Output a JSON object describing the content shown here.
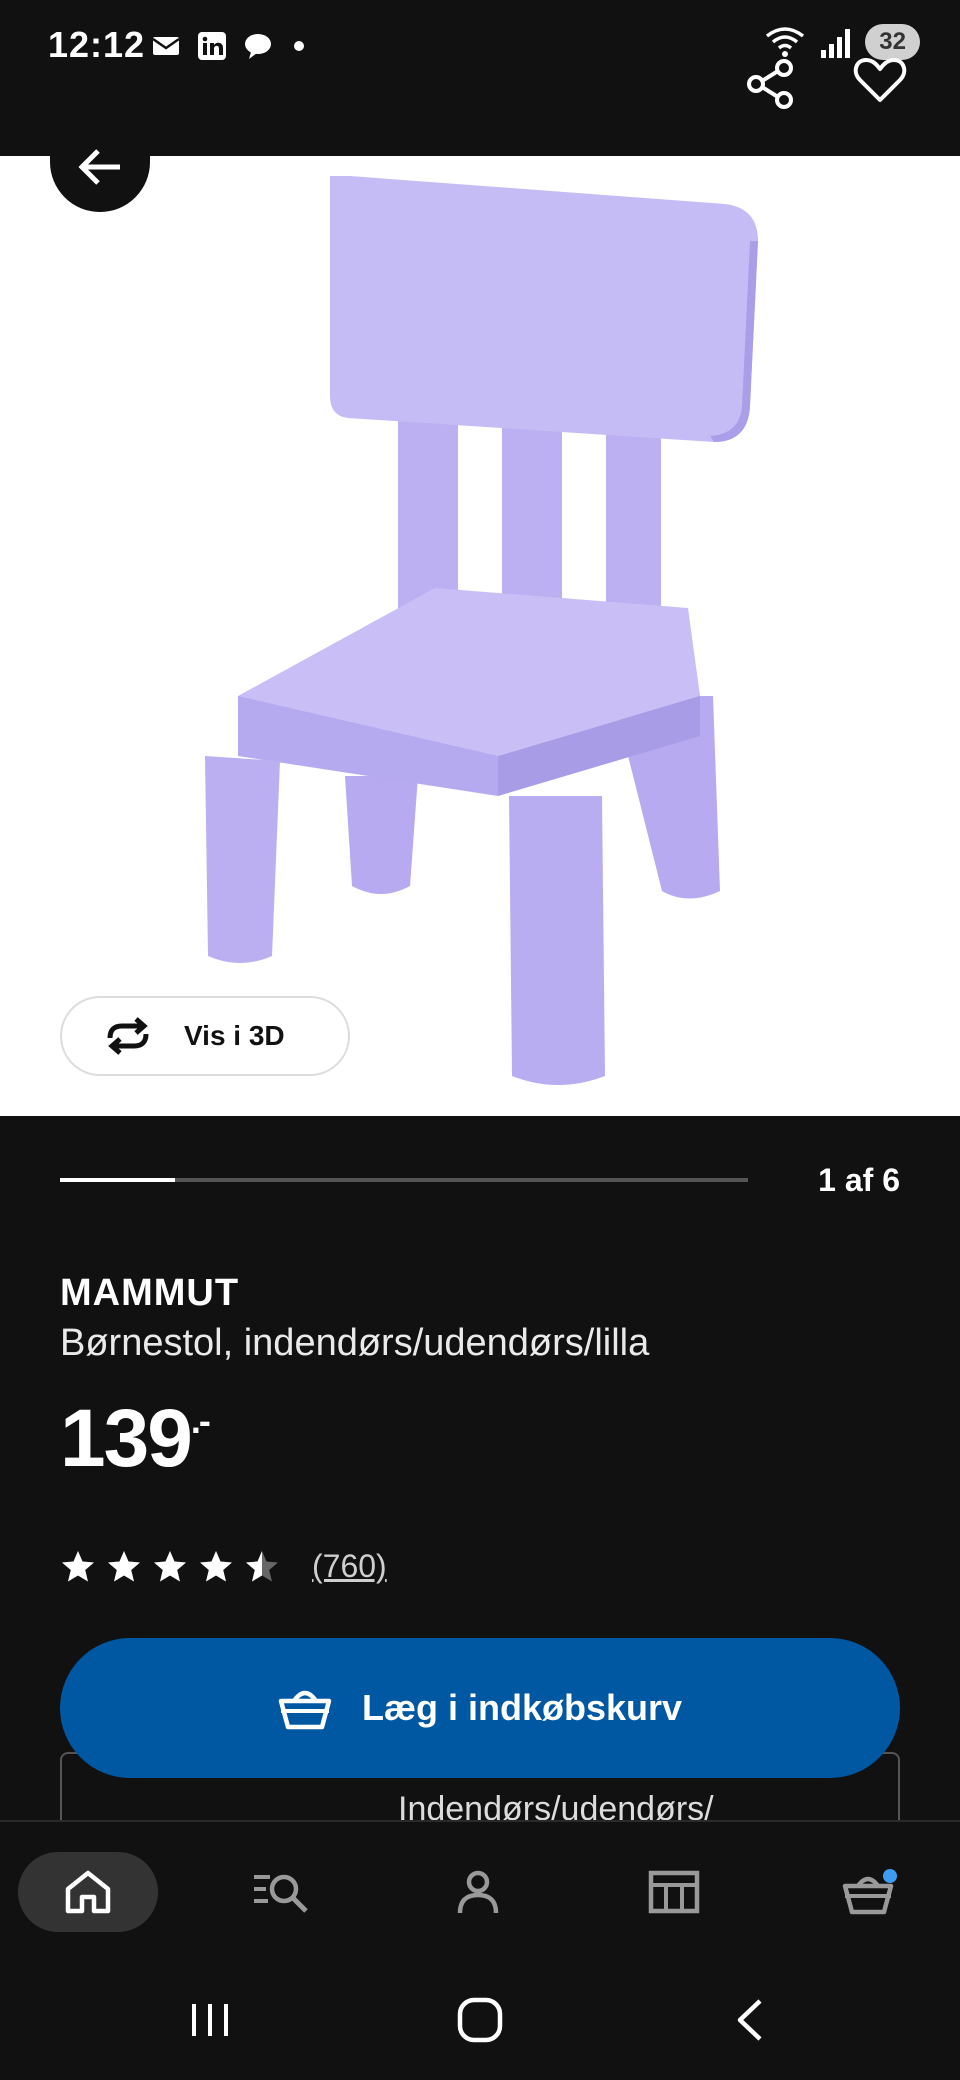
{
  "status_bar": {
    "time": "12:12",
    "battery": "32",
    "icons": [
      "mail-icon",
      "linkedin-icon",
      "chat-icon",
      "wifi-icon",
      "signal-icon"
    ]
  },
  "toolbar": {
    "back_icon": "arrow-left-icon",
    "share_icon": "share-icon",
    "favorite_icon": "heart-icon"
  },
  "hero": {
    "image": "purple-child-chair",
    "vis3d_label": "Vis i 3D"
  },
  "pager": {
    "label": "1 af 6",
    "progress_fraction": 0.1667
  },
  "product": {
    "brand": "MAMMUT",
    "description": "Børnestol, indendørs/udendørs/lilla",
    "price": "139",
    "price_suffix": ".-",
    "rating": 4.5,
    "rating_count": "(760)"
  },
  "actions": {
    "add_to_cart": "Læg i indkøbskurv",
    "option_text": "Indendørs/udendørs/"
  },
  "bottom_nav": {
    "items": [
      "home-icon",
      "search-icon",
      "profile-icon",
      "store-icon",
      "cart-icon"
    ],
    "active": "home-icon"
  },
  "system_nav": [
    "recents-icon",
    "home-button-icon",
    "back-icon"
  ],
  "colors": {
    "background": "#111111",
    "accent": "#0058a3",
    "chair": "#c4b9f3",
    "notification_dot": "#3d9cf0"
  }
}
